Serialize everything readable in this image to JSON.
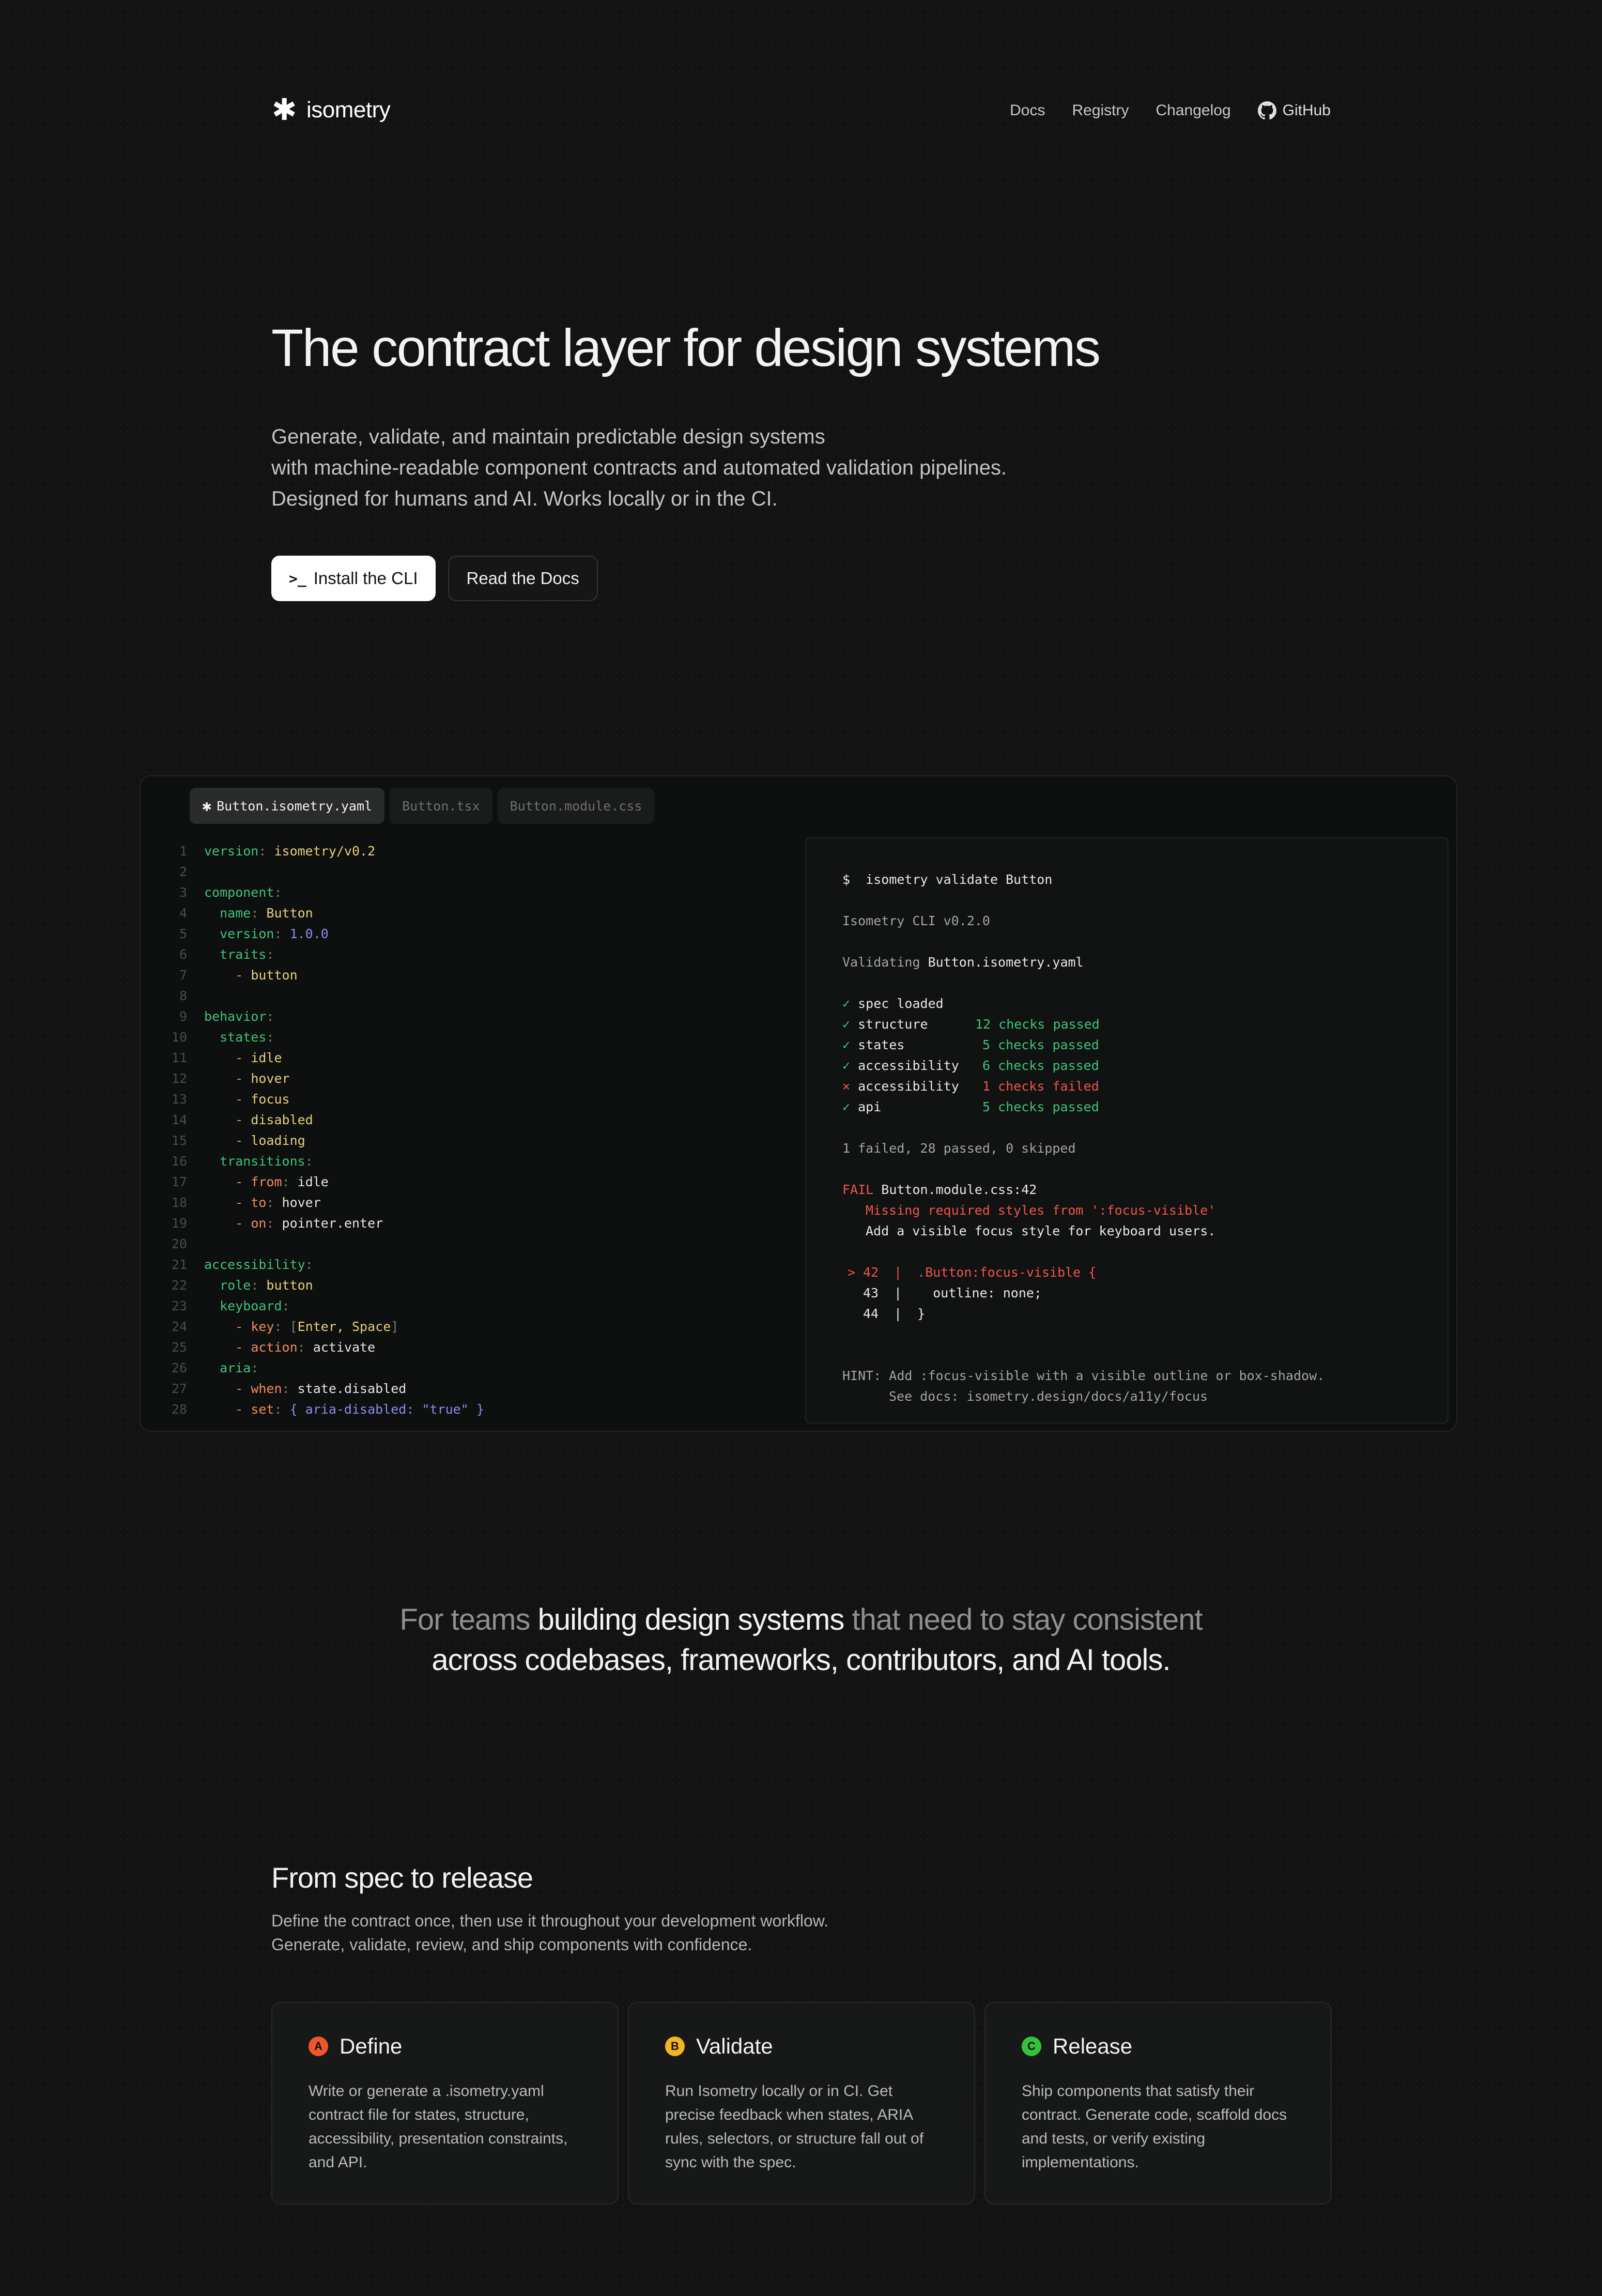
{
  "nav": {
    "logo_text": "isometry",
    "links": [
      "Docs",
      "Registry",
      "Changelog"
    ],
    "github_label": "GitHub"
  },
  "hero": {
    "title": "The contract layer for design systems",
    "subtitle": [
      "Generate, validate, and maintain predictable design systems",
      "with machine-readable component contracts and automated validation pipelines.",
      "Designed for humans and AI. Works locally or in the CI."
    ],
    "primary_button": "Install the CLI",
    "primary_button_icon": "terminal-icon",
    "secondary_button": "Read the Docs"
  },
  "editor": {
    "tabs": [
      "Button.isometry.yaml",
      "Button.tsx",
      "Button.module.css"
    ],
    "active_tab": 0,
    "line_numbers": [
      "1",
      "2",
      "3",
      "4",
      "5",
      "6",
      "7",
      "8",
      "9",
      "10",
      "11",
      "12",
      "13",
      "14",
      "15",
      "16",
      "17",
      "18",
      "19",
      "20",
      "21",
      "22",
      "23",
      "24",
      "25",
      "26",
      "27",
      "28"
    ]
  },
  "terminal": {
    "prompt": "$",
    "command": "isometry validate Button",
    "version_line": "Isometry CLI v0.2.0",
    "validating_label": "Validating",
    "validating_file": "Button.isometry.yaml",
    "checks": [
      {
        "mark": "✓",
        "name": "spec loaded",
        "result": "",
        "status": "pass"
      },
      {
        "mark": "✓",
        "name": "structure",
        "result": "12 checks passed",
        "status": "pass"
      },
      {
        "mark": "✓",
        "name": "states",
        "result": "5 checks passed",
        "status": "pass"
      },
      {
        "mark": "✓",
        "name": "accessibility",
        "result": "6 checks passed",
        "status": "pass"
      },
      {
        "mark": "×",
        "name": "accessibility",
        "result": "1 checks failed",
        "status": "fail"
      },
      {
        "mark": "✓",
        "name": "api",
        "result": "5 checks passed",
        "status": "pass"
      }
    ],
    "summary": "1 failed, 28 passed, 0 skipped",
    "fail_label": "FAIL",
    "fail_location": "Button.module.css:42",
    "fail_message": "Missing required styles from ':focus-visible'",
    "fail_help": "Add a visible focus style for keyboard users.",
    "snippet": [
      {
        "marker": ">",
        "lineno": "42",
        "code": ".Button:focus-visible {",
        "highlight": true
      },
      {
        "marker": "",
        "lineno": "43",
        "code": "  outline: none;",
        "highlight": false
      },
      {
        "marker": "",
        "lineno": "44",
        "code": "}",
        "highlight": false
      }
    ],
    "hint": "HINT: Add :focus-visible with a visible outline or box-shadow.",
    "hint_docs": "See docs: isometry.design/docs/a11y/focus"
  },
  "tagline": {
    "part1": "For teams ",
    "part2": "building design systems",
    "part3": " that need to stay consistent",
    "line2": "across codebases, frameworks, contributors, and AI tools."
  },
  "workflow": {
    "title": "From spec to release",
    "subtitle": [
      "Define the contract once, then use it throughout your development workflow.",
      "Generate, validate, review, and ship components with confidence."
    ],
    "cards": [
      {
        "badge": "A",
        "badge_color": "#f0562b",
        "title": "Define",
        "description": "Write or generate a .isometry.yaml contract file for states, structure, accessibility, presentation constraints, and API."
      },
      {
        "badge": "B",
        "badge_color": "#f3b51e",
        "title": "Validate",
        "description": "Run Isometry locally or in CI. Get precise feedback when states, ARIA rules, selectors, or structure fall out of sync with the spec."
      },
      {
        "badge": "C",
        "badge_color": "#34c23a",
        "title": "Release",
        "description": "Ship components that satisfy their contract. Generate code, scaffold docs and tests, or verify existing implementations."
      }
    ]
  },
  "colors": {
    "background": "#121312",
    "accent_green": "#3ec47a",
    "accent_red": "#f0554b",
    "yaml_key": "#3ec47a",
    "yaml_value": "#e7cf7c",
    "yaml_number": "#8a8cf0",
    "yaml_property": "#f08d5a"
  },
  "yaml_lines": [
    [
      {
        "t": "version",
        "c": "k"
      },
      {
        "t": ": ",
        "c": "dim"
      },
      {
        "t": "isometry/v0.2",
        "c": "v"
      }
    ],
    [],
    [
      {
        "t": "component",
        "c": "k"
      },
      {
        "t": ":",
        "c": "dim"
      }
    ],
    [
      {
        "t": "  name",
        "c": "k"
      },
      {
        "t": ": ",
        "c": "dim"
      },
      {
        "t": "Button",
        "c": "v"
      }
    ],
    [
      {
        "t": "  version",
        "c": "k"
      },
      {
        "t": ": ",
        "c": "dim"
      },
      {
        "t": "1.0.0",
        "c": "n"
      }
    ],
    [
      {
        "t": "  traits",
        "c": "k"
      },
      {
        "t": ":",
        "c": "dim"
      }
    ],
    [
      {
        "t": "    - ",
        "c": "p"
      },
      {
        "t": "button",
        "c": "v"
      }
    ],
    [],
    [
      {
        "t": "behavior",
        "c": "k"
      },
      {
        "t": ":",
        "c": "dim"
      }
    ],
    [
      {
        "t": "  states",
        "c": "k"
      },
      {
        "t": ":",
        "c": "dim"
      }
    ],
    [
      {
        "t": "    - ",
        "c": "p"
      },
      {
        "t": "idle",
        "c": "v"
      }
    ],
    [
      {
        "t": "    - ",
        "c": "p"
      },
      {
        "t": "hover",
        "c": "v"
      }
    ],
    [
      {
        "t": "    - ",
        "c": "p"
      },
      {
        "t": "focus",
        "c": "v"
      }
    ],
    [
      {
        "t": "    - ",
        "c": "p"
      },
      {
        "t": "disabled",
        "c": "v"
      }
    ],
    [
      {
        "t": "    - ",
        "c": "p"
      },
      {
        "t": "loading",
        "c": "v"
      }
    ],
    [
      {
        "t": "  transitions",
        "c": "k"
      },
      {
        "t": ":",
        "c": "dim"
      }
    ],
    [
      {
        "t": "    - ",
        "c": "p"
      },
      {
        "t": "from",
        "c": "p"
      },
      {
        "t": ": ",
        "c": "dim"
      },
      {
        "t": "idle",
        "c": "w"
      }
    ],
    [
      {
        "t": "    - ",
        "c": "p"
      },
      {
        "t": "to",
        "c": "p"
      },
      {
        "t": ": ",
        "c": "dim"
      },
      {
        "t": "hover",
        "c": "w"
      }
    ],
    [
      {
        "t": "    - ",
        "c": "p"
      },
      {
        "t": "on",
        "c": "p"
      },
      {
        "t": ": ",
        "c": "dim"
      },
      {
        "t": "pointer.enter",
        "c": "w"
      }
    ],
    [],
    [
      {
        "t": "accessibility",
        "c": "k"
      },
      {
        "t": ":",
        "c": "dim"
      }
    ],
    [
      {
        "t": "  role",
        "c": "k"
      },
      {
        "t": ": ",
        "c": "dim"
      },
      {
        "t": "button",
        "c": "v"
      }
    ],
    [
      {
        "t": "  keyboard",
        "c": "k"
      },
      {
        "t": ":",
        "c": "dim"
      }
    ],
    [
      {
        "t": "    - ",
        "c": "p"
      },
      {
        "t": "key",
        "c": "p"
      },
      {
        "t": ": ",
        "c": "dim"
      },
      {
        "t": "[",
        "c": "dim"
      },
      {
        "t": "Enter, Space",
        "c": "v"
      },
      {
        "t": "]",
        "c": "dim"
      }
    ],
    [
      {
        "t": "    - ",
        "c": "p"
      },
      {
        "t": "action",
        "c": "p"
      },
      {
        "t": ": ",
        "c": "dim"
      },
      {
        "t": "activate",
        "c": "w"
      }
    ],
    [
      {
        "t": "  aria",
        "c": "k"
      },
      {
        "t": ":",
        "c": "dim"
      }
    ],
    [
      {
        "t": "    - ",
        "c": "p"
      },
      {
        "t": "when",
        "c": "p"
      },
      {
        "t": ": ",
        "c": "dim"
      },
      {
        "t": "state.disabled",
        "c": "w"
      }
    ],
    [
      {
        "t": "    - ",
        "c": "p"
      },
      {
        "t": "set",
        "c": "p"
      },
      {
        "t": ": ",
        "c": "dim"
      },
      {
        "t": "{ aria-disabled: ",
        "c": "s"
      },
      {
        "t": "\"true\"",
        "c": "s"
      },
      {
        "t": " }",
        "c": "s"
      }
    ]
  ]
}
